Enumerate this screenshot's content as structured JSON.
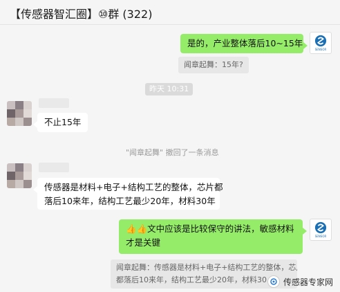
{
  "header": {
    "title": "【传感器智汇圈】⑩群 (322)"
  },
  "messages": {
    "m1": {
      "text": "是的，产业整体落后10~15年"
    },
    "q1": {
      "text": "闻章起舞：15年?"
    },
    "time1": {
      "text": "昨天 10:31"
    },
    "m2": {
      "text": "不止15年"
    },
    "sys1": {
      "text": "\"闻章起舞\" 撤回了一条消息"
    },
    "m3": {
      "line1": "传感器是材料+电子+结构工艺的整体，芯片都",
      "line2": "落后10来年，结构工艺最少20年，材料30年"
    },
    "m4": {
      "emoji": "👍👍",
      "line1": "文中应该是比较保守的讲法，敏感材料",
      "line2": "才是关键"
    },
    "q2": {
      "line1": "闻章起舞：传感器是材料+电子+结构工艺的整体，芯片",
      "line2": "都落后10来年，结构工艺最少20年，材料30..."
    }
  },
  "watermark": {
    "text": "传感器专家网"
  },
  "colors": {
    "self_bubble": "#95ec69",
    "other_bubble": "#ffffff",
    "background": "#f5f5f5"
  }
}
